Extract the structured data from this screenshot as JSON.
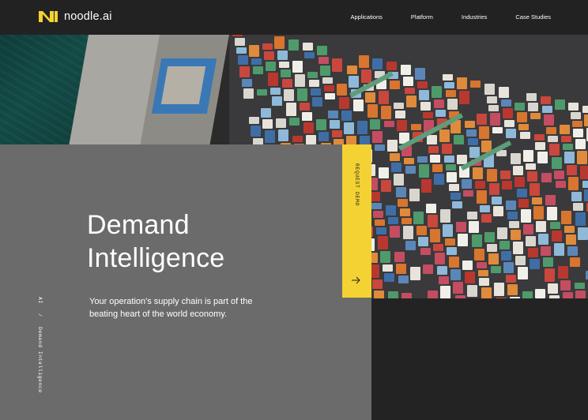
{
  "header": {
    "brand_name": "noodle.ai",
    "logo_icon": "noodle-n-logo-icon",
    "accent_color": "#f4d233",
    "nav_items": [
      {
        "label": "Applications"
      },
      {
        "label": "Platform"
      },
      {
        "label": "Industries"
      },
      {
        "label": "Case Studies"
      }
    ]
  },
  "hero": {
    "image_icon": "shipping-container-port-photo",
    "title_line1": "Demand",
    "title_line2": "Intelligence",
    "lead": "Your operation's supply chain is part of the beating heart of the world economy.",
    "breadcrumb": {
      "root": "AI",
      "separator": "/",
      "current": "Demand Intelligence"
    },
    "cta": {
      "label": "REQUEST DEMO",
      "icon": "arrow-right-icon"
    }
  }
}
